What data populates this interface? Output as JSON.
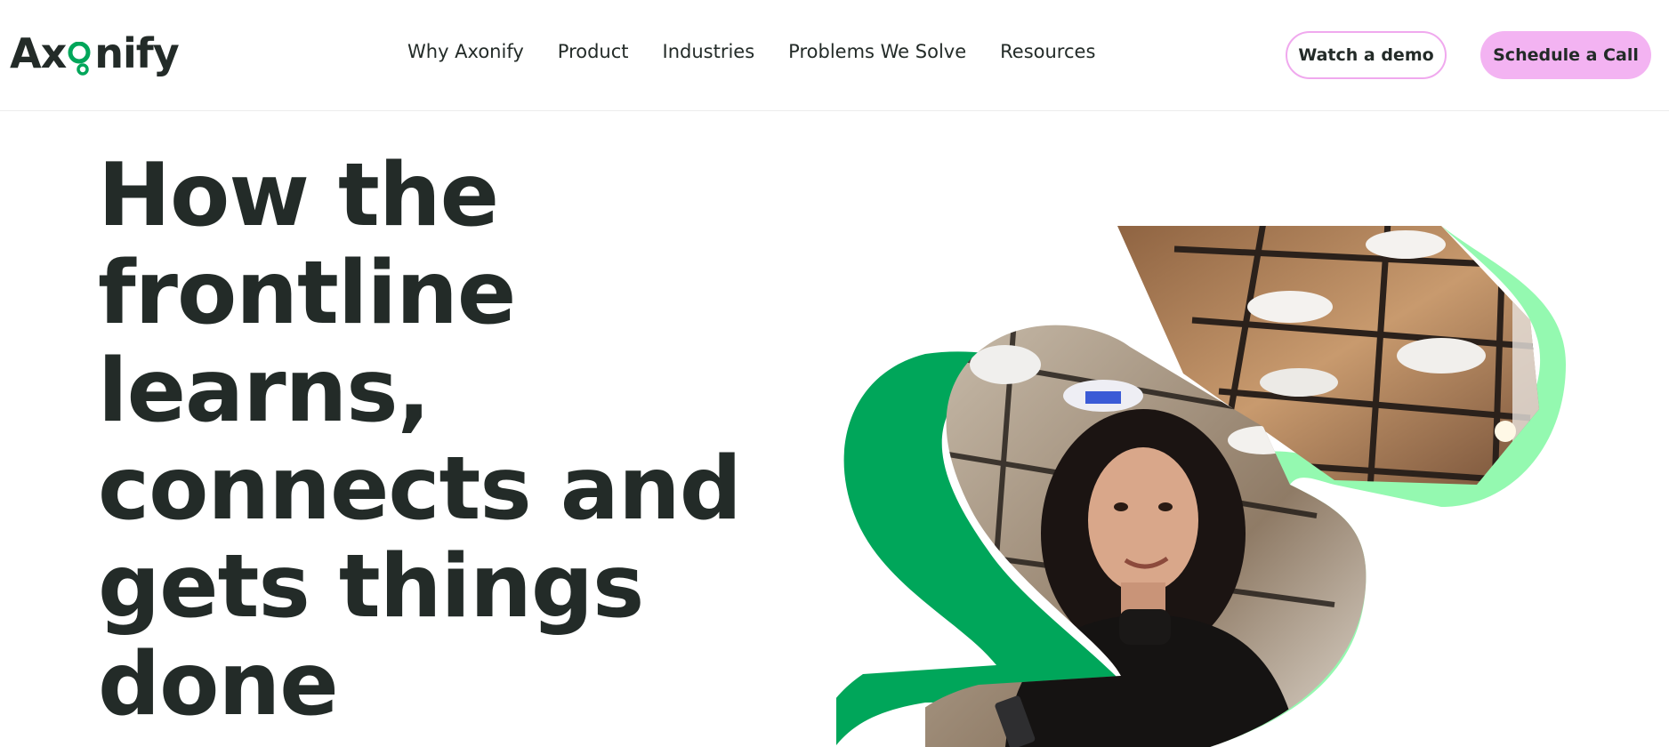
{
  "logo": {
    "text_before": "Ax",
    "text_after": "nify",
    "accent_color": "#00a65a"
  },
  "nav": {
    "items": [
      {
        "label": "Why Axonify"
      },
      {
        "label": "Product"
      },
      {
        "label": "Industries"
      },
      {
        "label": "Problems We Solve"
      },
      {
        "label": "Resources"
      }
    ]
  },
  "actions": {
    "watch_demo": "Watch a demo",
    "schedule_call": "Schedule a Call"
  },
  "hero": {
    "title_lines": [
      "How the",
      "frontline",
      "learns,",
      "connects and",
      "gets things",
      "done"
    ]
  },
  "colors": {
    "text": "#232b28",
    "green_dark": "#00a65a",
    "green_light": "#94f9b0",
    "pink": "#f3b3f2"
  }
}
